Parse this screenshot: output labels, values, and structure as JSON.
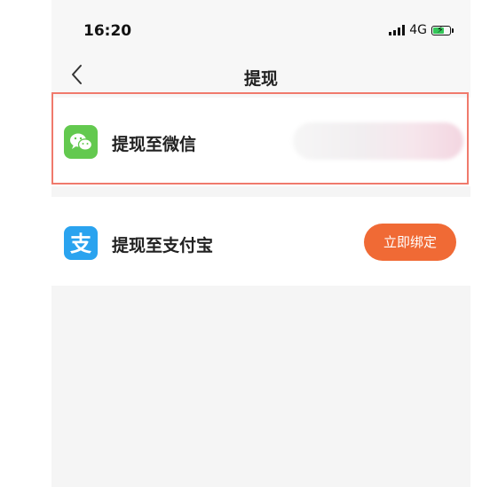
{
  "status_bar": {
    "time": "16:20",
    "network": "4G",
    "battery_color": "#34c759"
  },
  "header": {
    "back_icon": "chevron-left-icon",
    "title": "提现"
  },
  "options": {
    "wechat": {
      "icon": "wechat-icon",
      "icon_color": "#63c94f",
      "label": "提现至微信",
      "highlight_color": "#f07a6c"
    },
    "alipay": {
      "icon": "alipay-icon",
      "icon_color": "#2aa3ef",
      "label": "提现至支付宝",
      "button_label": "立即绑定",
      "button_color": "#f06a35"
    }
  }
}
